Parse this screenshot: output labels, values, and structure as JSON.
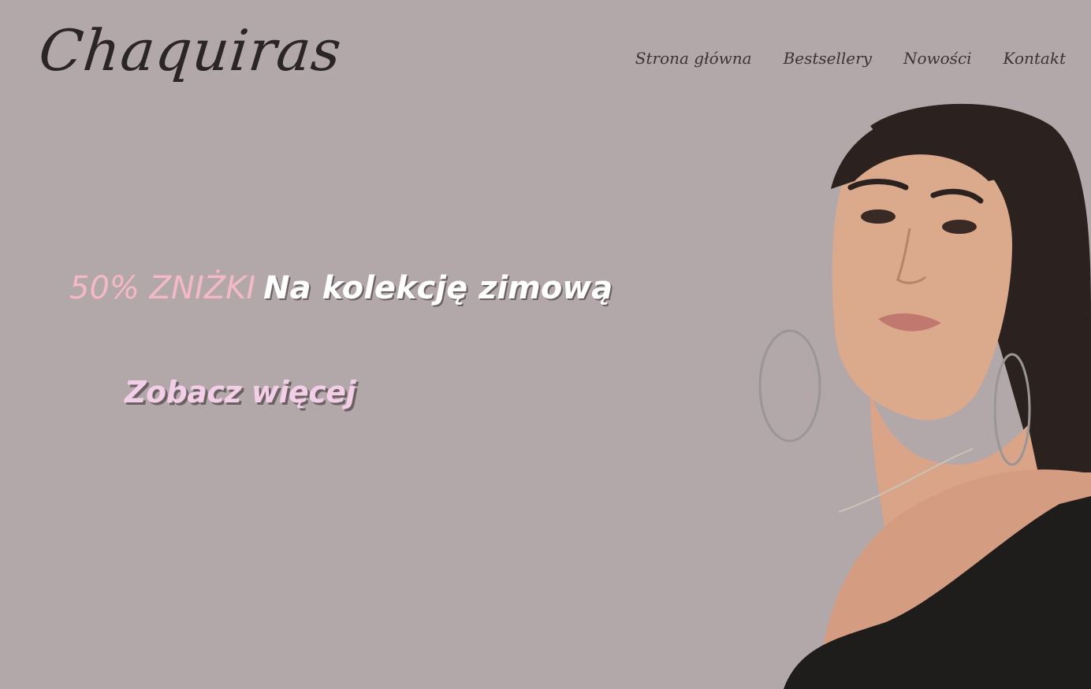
{
  "header": {
    "logo": "Chaquiras",
    "nav": [
      {
        "label": "Strona główna"
      },
      {
        "label": "Bestsellery"
      },
      {
        "label": "Nowości"
      },
      {
        "label": "Kontakt"
      }
    ]
  },
  "hero": {
    "discount": "50% ZNIŻKI",
    "headline": "Na kolekcję zimową",
    "cta_label": "Zobacz więcej",
    "image_alt": "woman-portrait"
  },
  "colors": {
    "background": "#b3a8a9",
    "discount": "#f4b9c6",
    "headline": "#ffffff",
    "cta": "#f2cfe6"
  }
}
